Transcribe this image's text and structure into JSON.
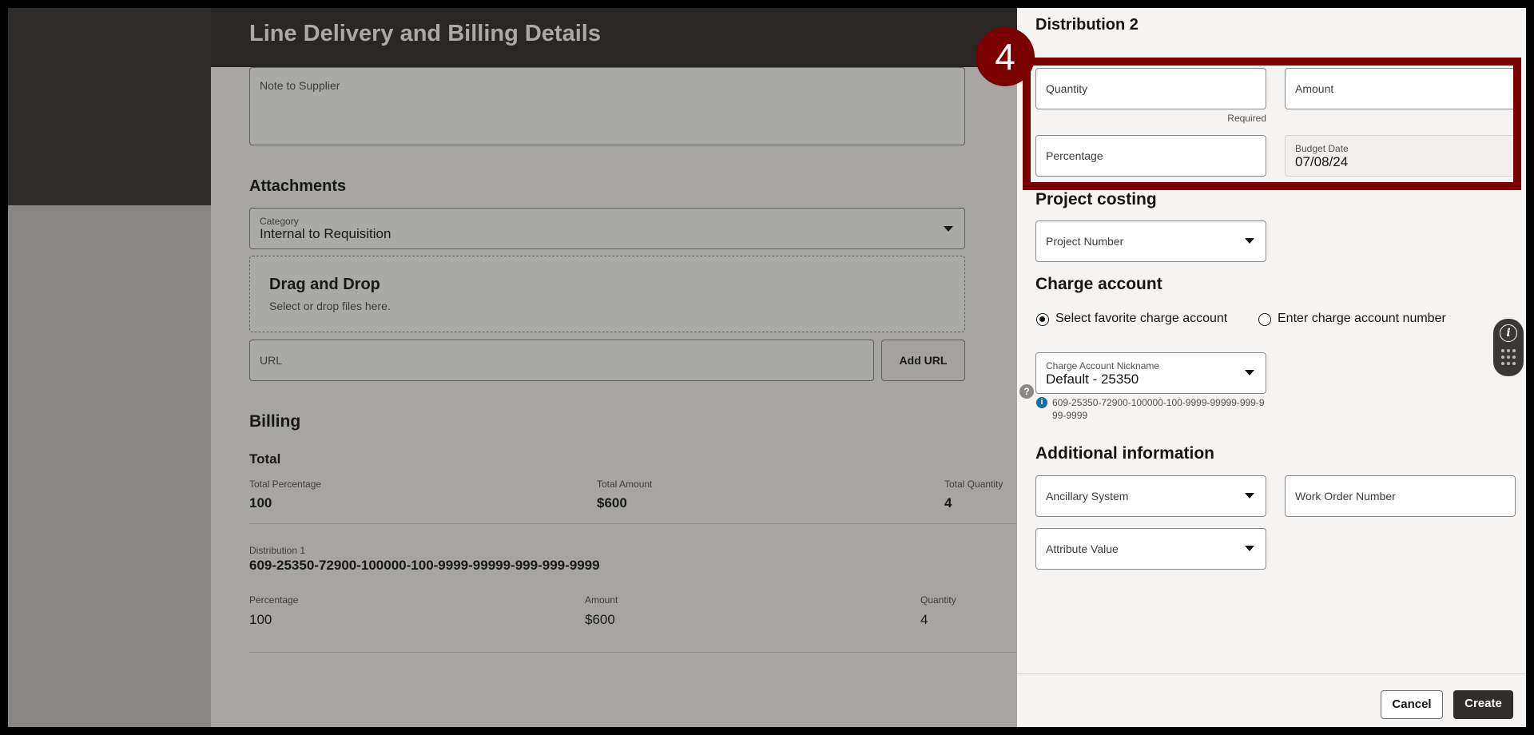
{
  "background": {
    "page_title": "Line Delivery and Billing Details",
    "note_to_supplier_placeholder": "Note to Supplier",
    "attachments": {
      "heading": "Attachments",
      "category_label": "Category",
      "category_value": "Internal to Requisition",
      "drag_drop_title": "Drag and Drop",
      "drag_drop_hint": "Select or drop files here.",
      "url_placeholder": "URL",
      "add_url_label": "Add URL"
    },
    "billing": {
      "heading": "Billing",
      "total_heading": "Total",
      "total_percentage_label": "Total Percentage",
      "total_percentage_value": "100",
      "total_amount_label": "Total Amount",
      "total_amount_value": "$600",
      "total_quantity_label": "Total Quantity",
      "total_quantity_value": "4",
      "distribution_label": "Distribution 1",
      "distribution_account": "609-25350-72900-100000-100-9999-99999-999-999-9999",
      "percentage_label": "Percentage",
      "percentage_value": "100",
      "amount_label": "Amount",
      "amount_value": "$600",
      "quantity_label": "Quantity",
      "quantity_value": "4"
    }
  },
  "drawer": {
    "title": "Distribution 2",
    "step_number": "4",
    "quantity_placeholder": "Quantity",
    "quantity_hint": "Required",
    "amount_placeholder": "Amount",
    "percentage_placeholder": "Percentage",
    "budget_date_label": "Budget Date",
    "budget_date_value": "07/08/24",
    "project_costing_heading": "Project costing",
    "project_number_placeholder": "Project Number",
    "charge_account_heading": "Charge account",
    "radio_favorite_label": "Select favorite charge account",
    "radio_enter_label": "Enter charge account number",
    "charge_nickname_label": "Charge Account Nickname",
    "charge_nickname_value": "Default - 25350",
    "charge_account_detail": "609-25350-72900-100000-100-9999-99999-999-999-9999",
    "additional_info_heading": "Additional information",
    "ancillary_system_placeholder": "Ancillary System",
    "work_order_placeholder": "Work Order Number",
    "attribute_value_placeholder": "Attribute Value",
    "cancel_label": "Cancel",
    "create_label": "Create"
  },
  "colors": {
    "highlight": "#7a0000",
    "header_dark": "#312d2a",
    "drawer_bg": "#f5f4f2"
  },
  "icons": {
    "help": "help-icon",
    "info": "info-icon",
    "widget": "info-widget-icon"
  }
}
